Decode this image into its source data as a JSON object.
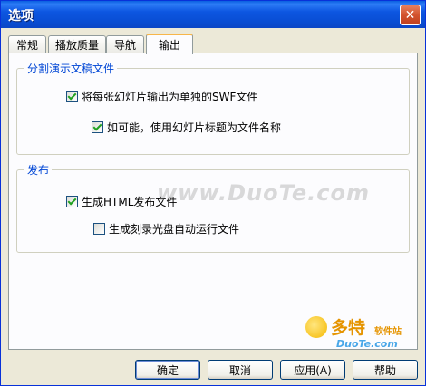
{
  "window": {
    "title": "选项",
    "close_glyph": "✕"
  },
  "tabs": [
    {
      "label": "常规",
      "active": false
    },
    {
      "label": "播放质量",
      "active": false
    },
    {
      "label": "导航",
      "active": false
    },
    {
      "label": "输出",
      "active": true
    }
  ],
  "groups": {
    "split": {
      "title": "分割演示文稿文件",
      "options": [
        {
          "label": "将每张幻灯片输出为单独的SWF文件",
          "checked": true
        },
        {
          "label": "如可能，使用幻灯片标题为文件名称",
          "checked": true
        }
      ]
    },
    "publish": {
      "title": "发布",
      "options": [
        {
          "label": "生成HTML发布文件",
          "checked": true
        },
        {
          "label": "生成刻录光盘自动运行文件",
          "checked": false
        }
      ]
    }
  },
  "buttons": {
    "ok": "确定",
    "cancel": "取消",
    "apply": "应用(A)",
    "help": "帮助"
  },
  "watermark": {
    "main": "www.DuoTe.com",
    "logo_main": "多特",
    "logo_sub": "软件站",
    "logo_url": "DuoTe.com"
  },
  "colors": {
    "titlebar": "#0a4fd6",
    "group_title": "#0046d5",
    "tab_highlight": "#f7b64a",
    "check_mark": "#21a121"
  },
  "icons": {
    "close": "close-icon",
    "check": "checkmark-icon"
  }
}
